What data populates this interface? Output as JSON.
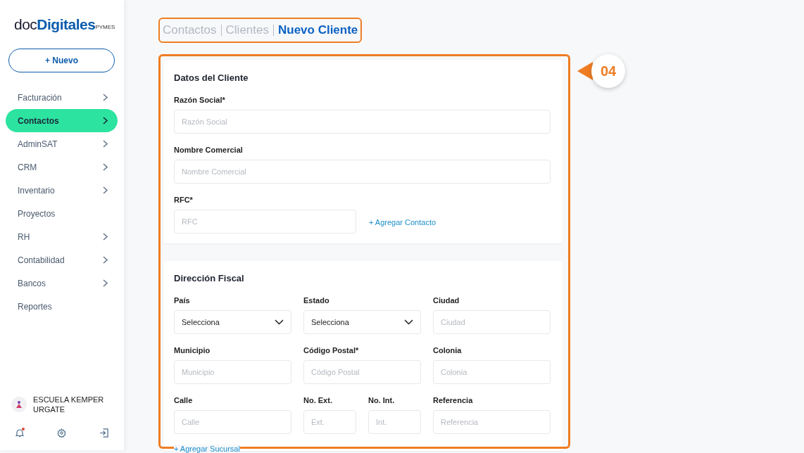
{
  "sidebar": {
    "logo": {
      "light": "doc",
      "bold": "Digitales",
      "suffix": "PYMES"
    },
    "new_button": "+ Nuevo",
    "items": [
      {
        "label": "Facturación",
        "arrow": true,
        "selected": false
      },
      {
        "label": "Contactos",
        "arrow": true,
        "selected": true
      },
      {
        "label": "AdminSAT",
        "arrow": true,
        "selected": false
      },
      {
        "label": "CRM",
        "arrow": true,
        "selected": false
      },
      {
        "label": "Inventario",
        "arrow": true,
        "selected": false
      },
      {
        "label": "Proyectos",
        "arrow": false,
        "selected": false
      },
      {
        "label": "RH",
        "arrow": true,
        "selected": false
      },
      {
        "label": "Contabilidad",
        "arrow": true,
        "selected": false
      },
      {
        "label": "Bancos",
        "arrow": true,
        "selected": false
      },
      {
        "label": "Reportes",
        "arrow": false,
        "selected": false
      }
    ],
    "user": "ESCUELA KEMPER URGATE",
    "notifications": true
  },
  "breadcrumb": [
    {
      "label": "Contactos",
      "selected": false
    },
    {
      "label": "Clientes",
      "selected": false
    },
    {
      "label": "Nuevo Cliente",
      "selected": true
    }
  ],
  "step_badge": "04",
  "sections": [
    {
      "title": "Datos del Cliente",
      "rows": [
        [
          {
            "kind": "input",
            "label": "Razón Social*",
            "placeholder": "Razón Social"
          }
        ],
        [
          {
            "kind": "input",
            "label": "Nombre Comercial",
            "placeholder": "Nombre Comercial"
          }
        ],
        [
          {
            "kind": "input",
            "label": "RFC*",
            "placeholder": "RFC"
          },
          {
            "kind": "link",
            "text": "+ Agregar Contacto"
          }
        ]
      ]
    },
    {
      "title": "Dirección Fiscal",
      "rows": [
        [
          {
            "kind": "select",
            "label": "País",
            "value": "Selecciona"
          },
          {
            "kind": "select",
            "label": "Estado",
            "value": "Selecciona"
          },
          {
            "kind": "input",
            "label": "Ciudad",
            "placeholder": "Ciudad"
          }
        ],
        [
          {
            "kind": "input",
            "label": "Municipio",
            "placeholder": "Municipio"
          },
          {
            "kind": "input",
            "label": "Código Postal*",
            "placeholder": "Código Postal"
          },
          {
            "kind": "input",
            "label": "Colonia",
            "placeholder": "Colonia"
          }
        ],
        [
          {
            "kind": "input",
            "label": "Calle",
            "placeholder": "Calle"
          },
          {
            "kind": "input",
            "label": "No. Ext.",
            "placeholder": "Ext."
          },
          {
            "kind": "input",
            "label": "No. Int.",
            "placeholder": "Int."
          },
          {
            "kind": "input",
            "label": "Referencia",
            "placeholder": "Referencia"
          }
        ]
      ]
    }
  ],
  "add_branch_link": "+ Agregar Sucursal"
}
